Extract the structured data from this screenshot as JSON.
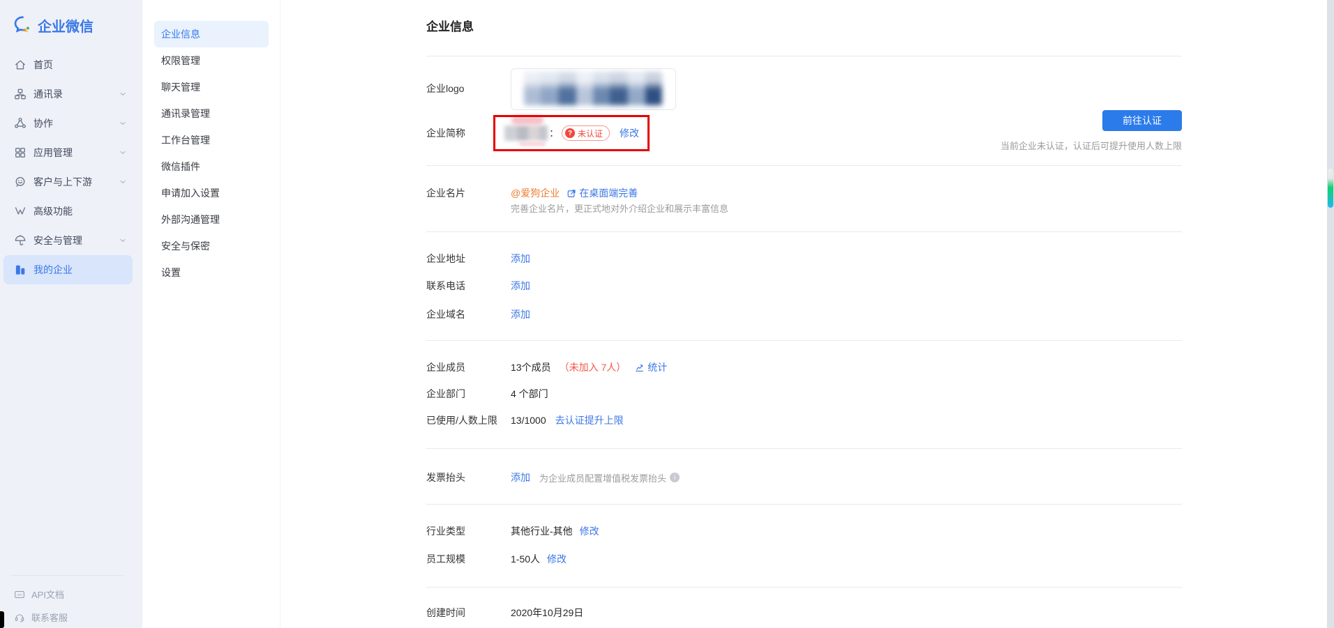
{
  "brand": {
    "name": "企业微信"
  },
  "colors": {
    "accent": "#2b7bea",
    "link": "#3b77e6",
    "orange": "#ed7b2f",
    "red": "#f25748",
    "annotation": "#e60000",
    "sidebar_bg": "#eef1f8",
    "selected_bg": "#d8e5fb"
  },
  "sidebar": {
    "items": [
      {
        "label": "首页",
        "icon": "home-icon",
        "chevron": false
      },
      {
        "label": "通讯录",
        "icon": "org-chart-icon",
        "chevron": true
      },
      {
        "label": "协作",
        "icon": "collaboration-icon",
        "chevron": true
      },
      {
        "label": "应用管理",
        "icon": "apps-grid-icon",
        "chevron": true
      },
      {
        "label": "客户与上下游",
        "icon": "customer-chat-icon",
        "chevron": true
      },
      {
        "label": "高级功能",
        "icon": "advanced-features-icon",
        "chevron": false
      },
      {
        "label": "安全与管理",
        "icon": "umbrella-icon",
        "chevron": true
      },
      {
        "label": "我的企业",
        "icon": "company-building-icon",
        "chevron": false,
        "active": true
      }
    ],
    "footer": [
      {
        "label": "API文档",
        "icon": "api-doc-icon"
      },
      {
        "label": "联系客服",
        "icon": "headset-icon"
      }
    ]
  },
  "submenu": {
    "items": [
      "企业信息",
      "权限管理",
      "聊天管理",
      "通讯录管理",
      "工作台管理",
      "微信插件",
      "申请加入设置",
      "外部沟通管理",
      "安全与保密",
      "设置"
    ]
  },
  "main": {
    "title": "企业信息",
    "logo_row": {
      "label": "企业logo"
    },
    "shortname": {
      "label": "企业简称",
      "colon": "：",
      "badge": "未认证",
      "modify": "修改"
    },
    "verify": {
      "button": "前往认证",
      "note": "当前企业未认证，认证后可提升使用人数上限"
    },
    "card": {
      "label": "企业名片",
      "org": "@爱狗企业",
      "link": "在桌面端完善",
      "desc": "完善企业名片，更正式地对外介绍企业和展示丰富信息"
    },
    "address": {
      "label": "企业地址",
      "action": "添加"
    },
    "phone": {
      "label": "联系电话",
      "action": "添加"
    },
    "domain": {
      "label": "企业域名",
      "action": "添加"
    },
    "members": {
      "label": "企业成员",
      "value": "13个成员",
      "pending": "（未加入 7人）",
      "stats": "统计"
    },
    "dept": {
      "label": "企业部门",
      "value": "4 个部门"
    },
    "usage": {
      "label": "已使用/人数上限",
      "value": "13/1000",
      "action": "去认证提升上限"
    },
    "invoice": {
      "label": "发票抬头",
      "action": "添加",
      "desc": "为企业成员配置增值税发票抬头"
    },
    "industry": {
      "label": "行业类型",
      "value": "其他行业-其他",
      "action": "修改"
    },
    "scale": {
      "label": "员工规模",
      "value": "1-50人",
      "action": "修改"
    },
    "created": {
      "label": "创建时间",
      "value": "2020年10月29日"
    }
  }
}
